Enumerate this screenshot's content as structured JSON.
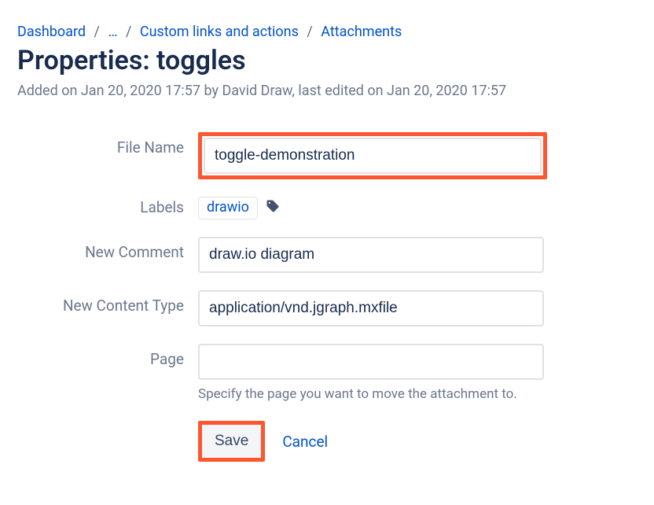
{
  "breadcrumb": {
    "dashboard": "Dashboard",
    "ellipsis": "…",
    "custom": "Custom links and actions",
    "attachments": "Attachments"
  },
  "page_title": "Properties: toggles",
  "meta_line": "Added on Jan 20, 2020 17:57 by David Draw, last edited on Jan 20, 2020 17:57",
  "form": {
    "file_name": {
      "label": "File Name",
      "value": "toggle-demonstration"
    },
    "labels": {
      "label": "Labels",
      "chips": [
        "drawio"
      ]
    },
    "new_comment": {
      "label": "New Comment",
      "value": "draw.io diagram"
    },
    "new_content_type": {
      "label": "New Content Type",
      "value": "application/vnd.jgraph.mxfile"
    },
    "page": {
      "label": "Page",
      "value": "",
      "helper": "Specify the page you want to move the attachment to."
    }
  },
  "actions": {
    "save": "Save",
    "cancel": "Cancel"
  }
}
